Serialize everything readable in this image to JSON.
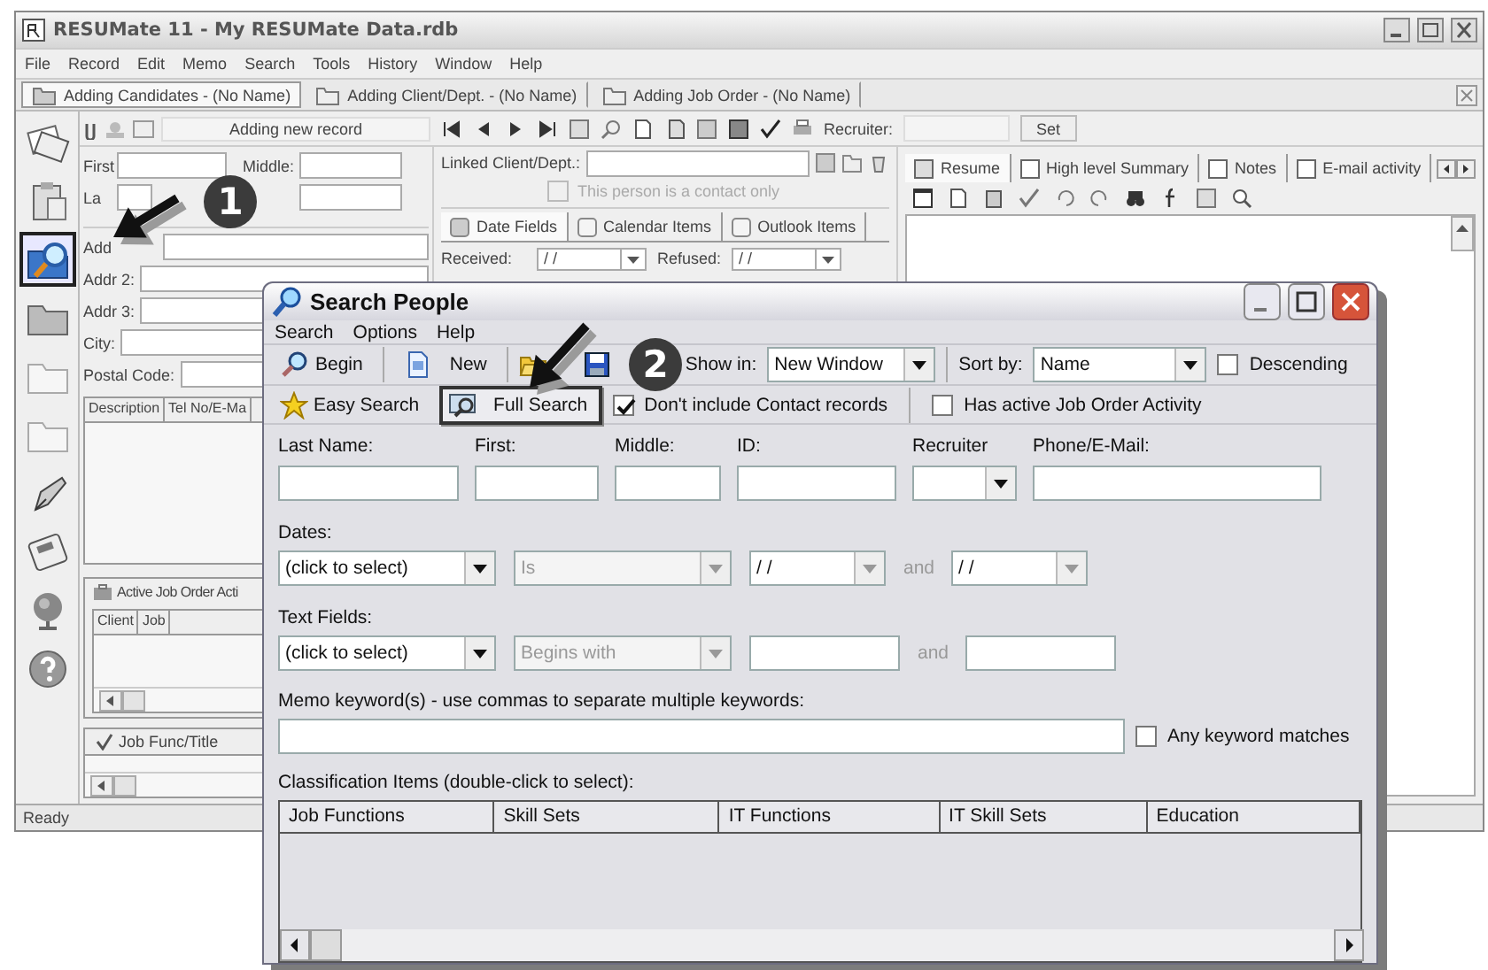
{
  "app": {
    "title": "RESUMate 11 - My RESUMate Data.rdb",
    "menu": [
      "File",
      "Record",
      "Edit",
      "Memo",
      "Search",
      "Tools",
      "History",
      "Window",
      "Help"
    ],
    "doc_tabs": [
      {
        "label": "Adding Candidates - (No Name)",
        "selected": true
      },
      {
        "label": "Adding Client/Dept. - (No Name)",
        "selected": false
      },
      {
        "label": "Adding Job Order - (No Name)",
        "selected": false
      }
    ],
    "sidebar": [
      {
        "kind": "cards",
        "selected": false
      },
      {
        "kind": "clipboard",
        "selected": false
      },
      {
        "kind": "search",
        "selected": true
      },
      {
        "kind": "folder",
        "selected": false
      },
      {
        "kind": "folder-outline",
        "selected": false
      },
      {
        "kind": "folder-outline",
        "selected": false
      },
      {
        "kind": "pen",
        "selected": false
      },
      {
        "kind": "calculator",
        "selected": false
      },
      {
        "kind": "globe",
        "selected": false
      },
      {
        "kind": "help",
        "selected": false
      }
    ],
    "record_status": "Adding new record",
    "recruiter_label": "Recruiter:",
    "set_button": "Set",
    "name_row": [
      {
        "label": "First"
      },
      {
        "label": "Middle:"
      }
    ],
    "last_label": "La",
    "address_fields": [
      {
        "label": "Add"
      },
      {
        "label": "Addr 2:"
      },
      {
        "label": "Addr 3:"
      },
      {
        "label": "City:"
      },
      {
        "label": "Postal Code:"
      }
    ],
    "contact_columns": [
      "Description",
      "Tel No/E-Ma"
    ],
    "job_panel": {
      "title": "Active Job Order Acti",
      "columns": [
        "Client",
        "Job"
      ]
    },
    "job_func": "Job Func/Title",
    "linked_label": "Linked Client/Dept.:",
    "contact_only": {
      "label": "This person is a contact only",
      "checked": false,
      "disabled": true
    },
    "date_tabs": [
      {
        "label": "Date Fields",
        "selected": true
      },
      {
        "label": "Calendar Items",
        "selected": false
      },
      {
        "label": "Outlook Items",
        "selected": false
      }
    ],
    "date_fields": [
      {
        "label": "Received:",
        "value": "/ /"
      },
      {
        "label": "Refused:",
        "value": "/ /"
      }
    ],
    "memo_tabs": [
      {
        "label": "Resume",
        "selected": true
      },
      {
        "label": "High level Summary",
        "selected": false
      },
      {
        "label": "Notes",
        "selected": false
      },
      {
        "label": "E-mail activity",
        "selected": false
      }
    ],
    "status": "Ready"
  },
  "dialog": {
    "title": "Search People",
    "menu": [
      "Search",
      "Options",
      "Help"
    ],
    "toolbar": [
      {
        "kind": "begin",
        "label": "Begin"
      },
      {
        "kind": "new",
        "label": "New"
      },
      {
        "kind": "open"
      },
      {
        "kind": "save"
      }
    ],
    "show_in": {
      "label": "Show in:",
      "value": "New Window"
    },
    "sort_by": {
      "label": "Sort by:",
      "value": "Name"
    },
    "descending": {
      "label": "Descending",
      "checked": false
    },
    "modes": [
      {
        "label": "Easy Search",
        "selected": false
      },
      {
        "label": "Full Search",
        "selected": true
      }
    ],
    "options": [
      {
        "label": "Don't include Contact records",
        "checked": true
      },
      {
        "label": "Has active Job Order Activity",
        "checked": false
      }
    ],
    "fields": [
      {
        "label": "Last Name:",
        "kind": "text"
      },
      {
        "label": "First:",
        "kind": "text"
      },
      {
        "label": "Middle:",
        "kind": "text"
      },
      {
        "label": "ID:",
        "kind": "text"
      },
      {
        "label": "Recruiter",
        "kind": "select"
      },
      {
        "label": "Phone/E-Mail:",
        "kind": "text"
      }
    ],
    "dates": {
      "label": "Dates:",
      "controls": [
        {
          "kind": "select",
          "value": "(click to select)",
          "disabled": false
        },
        {
          "kind": "select",
          "value": "Is",
          "disabled": true
        },
        {
          "kind": "date",
          "value": "/ /"
        },
        {
          "kind": "joiner",
          "text": "and"
        },
        {
          "kind": "date",
          "value": "/ /"
        }
      ]
    },
    "text_fields": {
      "label": "Text Fields:",
      "controls": [
        {
          "kind": "select",
          "value": "(click to select)",
          "disabled": false
        },
        {
          "kind": "select",
          "value": "Begins with",
          "disabled": true
        },
        {
          "kind": "input"
        },
        {
          "kind": "joiner",
          "text": "and"
        },
        {
          "kind": "input"
        }
      ]
    },
    "memo": {
      "label": "Memo keyword(s) - use commas to separate multiple keywords:"
    },
    "any_keyword": {
      "label": "Any keyword matches",
      "checked": false
    },
    "classification": {
      "label": "Classification Items (double-click to select):",
      "columns": [
        "Job Functions",
        "Skill Sets",
        "IT Functions",
        "IT Skill Sets",
        "Education"
      ]
    }
  },
  "callouts": [
    {
      "number": "1"
    },
    {
      "number": "2"
    }
  ]
}
